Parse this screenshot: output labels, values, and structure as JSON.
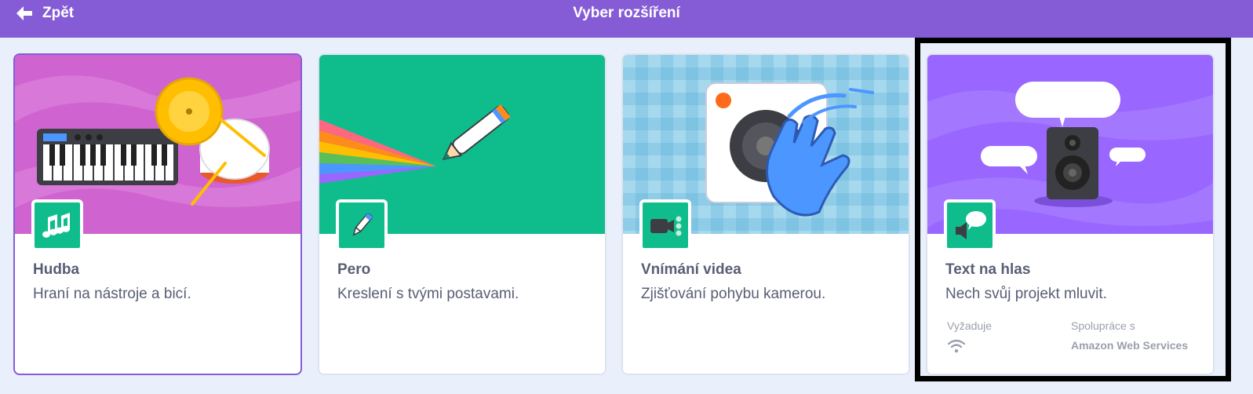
{
  "header": {
    "back_label": "Zpět",
    "title": "Vyber rozšíření",
    "color": "#855cd6"
  },
  "extensions": [
    {
      "name": "Hudba",
      "description": "Hraní na nástroje a bicí.",
      "icon": "music-notes-icon",
      "banner_color": "#cf63cf",
      "selected": true
    },
    {
      "name": "Pero",
      "description": "Kreslení s tvými postavami.",
      "icon": "pen-icon",
      "banner_color": "#0fbd8c"
    },
    {
      "name": "Vnímání videa",
      "description": "Zjišťování pohybu kamerou.",
      "icon": "video-camera-icon",
      "banner_color": "#8fcce8"
    },
    {
      "name": "Text na hlas",
      "description": "Nech svůj projekt mluvit.",
      "icon": "speaker-speech-icon",
      "banner_color": "#9966ff",
      "requires_label": "Vyžaduje",
      "requires_icon": "wifi-icon",
      "collaboration_label": "Spolupráce s",
      "collaboration_value": "Amazon Web Services"
    }
  ]
}
